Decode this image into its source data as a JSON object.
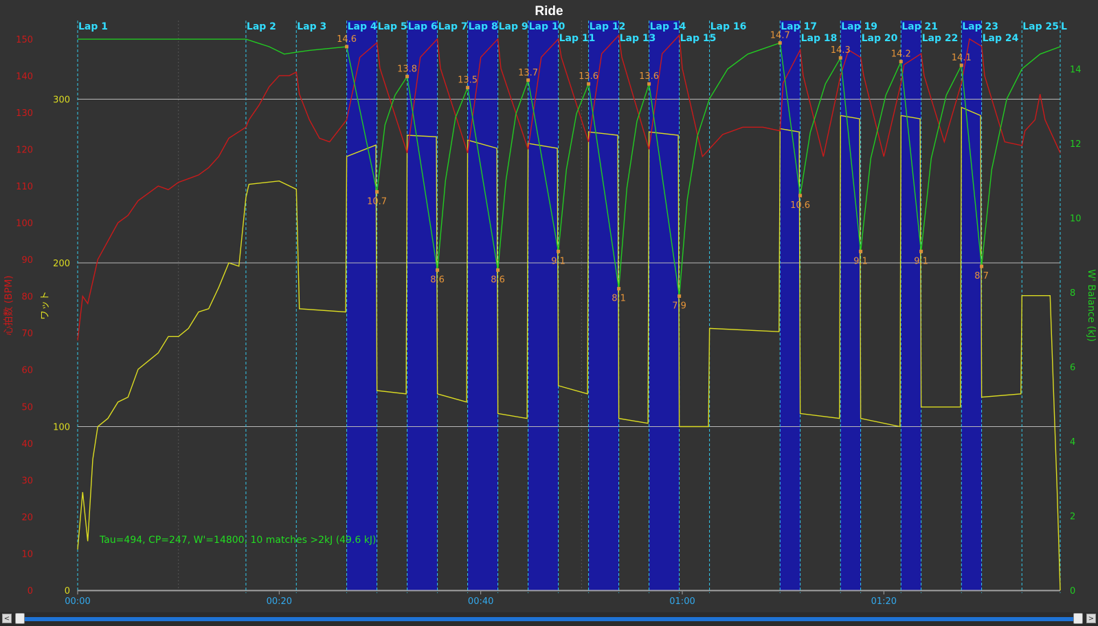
{
  "chart_data": {
    "type": "line",
    "title": "Ride",
    "x_axis": {
      "label": "",
      "ticks": [
        "00:00",
        "00:20",
        "00:40",
        "01:00",
        "01:20"
      ],
      "range_minutes": [
        0,
        97.5
      ]
    },
    "y_axes": [
      {
        "id": "hr",
        "label": "心拍数 (BPM)",
        "range": [
          0,
          155
        ],
        "ticks": [
          0,
          10,
          20,
          30,
          40,
          50,
          60,
          70,
          80,
          90,
          100,
          110,
          120,
          130,
          140,
          150
        ],
        "color": "#cc1a1a"
      },
      {
        "id": "power",
        "label": "ワット",
        "range": [
          0,
          348
        ],
        "ticks": [
          100,
          200,
          300
        ],
        "color": "#dddd22"
      },
      {
        "id": "wbal",
        "label": "W' Balance (kJ)",
        "range": [
          0,
          15.3
        ],
        "ticks": [
          0,
          2,
          4,
          6,
          8,
          10,
          12,
          14
        ],
        "color": "#22cc22"
      }
    ],
    "grid": "horizontal at power ticks",
    "annotation": "Tau=494, CP=247, W'=14800, 10 matches >2kJ (49.6 kJ)",
    "laps": [
      {
        "label": "Lap 1",
        "start": 0,
        "row": 1
      },
      {
        "label": "Lap 2",
        "start": 16.7,
        "row": 1
      },
      {
        "label": "Lap 3",
        "start": 21.7,
        "row": 1
      },
      {
        "label": "Lap 4",
        "start": 26.7,
        "row": 1,
        "interval": true
      },
      {
        "label": "Lap 5",
        "start": 29.7,
        "row": 1
      },
      {
        "label": "Lap 6",
        "start": 32.7,
        "row": 1,
        "interval": true
      },
      {
        "label": "Lap 7",
        "start": 35.7,
        "row": 1
      },
      {
        "label": "Lap 8",
        "start": 38.7,
        "row": 1,
        "interval": true
      },
      {
        "label": "Lap 9",
        "start": 41.7,
        "row": 1
      },
      {
        "label": "Lap 10",
        "start": 44.7,
        "row": 1,
        "interval": true
      },
      {
        "label": "Lap 11",
        "start": 47.7,
        "row": 2
      },
      {
        "label": "Lap 12",
        "start": 50.7,
        "row": 1,
        "interval": true
      },
      {
        "label": "Lap 13",
        "start": 53.7,
        "row": 2
      },
      {
        "label": "Lap 14",
        "start": 56.7,
        "row": 1,
        "interval": true
      },
      {
        "label": "Lap 15",
        "start": 59.7,
        "row": 2
      },
      {
        "label": "Lap 16",
        "start": 62.7,
        "row": 1
      },
      {
        "label": "Lap 17",
        "start": 69.7,
        "row": 1,
        "interval": true
      },
      {
        "label": "Lap 18",
        "start": 71.7,
        "row": 2
      },
      {
        "label": "Lap 19",
        "start": 75.7,
        "row": 1,
        "interval": true
      },
      {
        "label": "Lap 20",
        "start": 77.7,
        "row": 2
      },
      {
        "label": "Lap 21",
        "start": 81.7,
        "row": 1,
        "interval": true
      },
      {
        "label": "Lap 22",
        "start": 83.7,
        "row": 2
      },
      {
        "label": "Lap 23",
        "start": 87.7,
        "row": 1,
        "interval": true
      },
      {
        "label": "Lap 24",
        "start": 89.7,
        "row": 2
      },
      {
        "label": "Lap 25",
        "start": 93.7,
        "row": 1
      },
      {
        "label": "L",
        "start": 97.5,
        "row": 1
      }
    ],
    "wbal_markers": [
      {
        "t": 26.7,
        "v": 14.6,
        "label": "14.6"
      },
      {
        "t": 29.7,
        "v": 10.7,
        "label": "10.7"
      },
      {
        "t": 32.7,
        "v": 13.8,
        "label": "13.8"
      },
      {
        "t": 35.7,
        "v": 8.6,
        "label": "8.6"
      },
      {
        "t": 38.7,
        "v": 13.5,
        "label": "13.5"
      },
      {
        "t": 41.7,
        "v": 8.6,
        "label": "8.6"
      },
      {
        "t": 44.7,
        "v": 13.7,
        "label": "13.7"
      },
      {
        "t": 47.7,
        "v": 9.1,
        "label": "9.1"
      },
      {
        "t": 50.7,
        "v": 13.6,
        "label": "13.6"
      },
      {
        "t": 53.7,
        "v": 8.1,
        "label": "8.1"
      },
      {
        "t": 56.7,
        "v": 13.6,
        "label": "13.6"
      },
      {
        "t": 59.7,
        "v": 7.9,
        "label": "7.9"
      },
      {
        "t": 69.7,
        "v": 14.7,
        "label": "14.7"
      },
      {
        "t": 71.7,
        "v": 10.6,
        "label": "10.6"
      },
      {
        "t": 75.7,
        "v": 14.3,
        "label": "14.3"
      },
      {
        "t": 77.7,
        "v": 9.1,
        "label": "9.1"
      },
      {
        "t": 81.7,
        "v": 14.2,
        "label": "14.2"
      },
      {
        "t": 83.7,
        "v": 9.1,
        "label": "9.1"
      },
      {
        "t": 87.7,
        "v": 14.1,
        "label": "14.1"
      },
      {
        "t": 89.7,
        "v": 8.7,
        "label": "8.7"
      }
    ],
    "series": [
      {
        "name": "Power",
        "axis": "power",
        "color": "#dddd22",
        "points": [
          [
            0,
            25
          ],
          [
            0.5,
            60
          ],
          [
            1,
            30
          ],
          [
            1.5,
            80
          ],
          [
            2,
            100
          ],
          [
            3,
            105
          ],
          [
            4,
            115
          ],
          [
            5,
            118
          ],
          [
            6,
            135
          ],
          [
            7,
            140
          ],
          [
            8,
            145
          ],
          [
            9,
            155
          ],
          [
            10,
            155
          ],
          [
            11,
            160
          ],
          [
            12,
            170
          ],
          [
            13,
            172
          ],
          [
            14,
            185
          ],
          [
            15,
            200
          ],
          [
            16,
            198
          ],
          [
            16.7,
            240
          ],
          [
            17,
            248
          ],
          [
            20,
            250
          ],
          [
            21.7,
            245
          ],
          [
            22,
            172
          ],
          [
            26.6,
            170
          ],
          [
            26.7,
            265
          ],
          [
            29.6,
            272
          ],
          [
            29.7,
            122
          ],
          [
            32.6,
            120
          ],
          [
            32.7,
            278
          ],
          [
            35.6,
            277
          ],
          [
            35.7,
            120
          ],
          [
            38.6,
            115
          ],
          [
            38.7,
            275
          ],
          [
            41.6,
            270
          ],
          [
            41.7,
            108
          ],
          [
            44.6,
            105
          ],
          [
            44.7,
            273
          ],
          [
            47.6,
            270
          ],
          [
            47.7,
            125
          ],
          [
            50.6,
            120
          ],
          [
            50.7,
            280
          ],
          [
            53.6,
            278
          ],
          [
            53.7,
            105
          ],
          [
            56.6,
            102
          ],
          [
            56.7,
            280
          ],
          [
            59.6,
            278
          ],
          [
            59.7,
            100
          ],
          [
            62.6,
            100
          ],
          [
            62.7,
            160
          ],
          [
            69.6,
            158
          ],
          [
            69.7,
            282
          ],
          [
            71.6,
            280
          ],
          [
            71.7,
            108
          ],
          [
            75.6,
            105
          ],
          [
            75.7,
            290
          ],
          [
            77.6,
            288
          ],
          [
            77.7,
            105
          ],
          [
            81.6,
            100
          ],
          [
            81.7,
            290
          ],
          [
            83.6,
            288
          ],
          [
            83.7,
            112
          ],
          [
            87.6,
            112
          ],
          [
            87.7,
            295
          ],
          [
            89.6,
            290
          ],
          [
            89.7,
            118
          ],
          [
            93.6,
            120
          ],
          [
            93.7,
            180
          ],
          [
            96.5,
            180
          ],
          [
            97.2,
            60
          ],
          [
            97.5,
            0
          ]
        ]
      },
      {
        "name": "Heart Rate",
        "axis": "hr",
        "color": "#cc1a1a",
        "points": [
          [
            0,
            68
          ],
          [
            0.5,
            80
          ],
          [
            1,
            78
          ],
          [
            2,
            90
          ],
          [
            3,
            95
          ],
          [
            4,
            100
          ],
          [
            5,
            102
          ],
          [
            6,
            106
          ],
          [
            7,
            108
          ],
          [
            8,
            110
          ],
          [
            9,
            109
          ],
          [
            10,
            111
          ],
          [
            11,
            112
          ],
          [
            12,
            113
          ],
          [
            13,
            115
          ],
          [
            14,
            118
          ],
          [
            15,
            123
          ],
          [
            16.7,
            126
          ],
          [
            17,
            128
          ],
          [
            18,
            132
          ],
          [
            19,
            137
          ],
          [
            20,
            140
          ],
          [
            21,
            140
          ],
          [
            21.7,
            141
          ],
          [
            22,
            135
          ],
          [
            23,
            128
          ],
          [
            24,
            123
          ],
          [
            25,
            122
          ],
          [
            26.7,
            128
          ],
          [
            28,
            145
          ],
          [
            29.7,
            149
          ],
          [
            30,
            142
          ],
          [
            32.7,
            119
          ],
          [
            34,
            145
          ],
          [
            35.7,
            150
          ],
          [
            36,
            142
          ],
          [
            38.7,
            119
          ],
          [
            40,
            145
          ],
          [
            41.7,
            150
          ],
          [
            42,
            142
          ],
          [
            44.7,
            120
          ],
          [
            46,
            145
          ],
          [
            47.7,
            150
          ],
          [
            48,
            145
          ],
          [
            50.7,
            122
          ],
          [
            52,
            146
          ],
          [
            53.7,
            151
          ],
          [
            54,
            145
          ],
          [
            56.7,
            120
          ],
          [
            58,
            146
          ],
          [
            59.7,
            151
          ],
          [
            60,
            142
          ],
          [
            62,
            118
          ],
          [
            64,
            124
          ],
          [
            66,
            126
          ],
          [
            68,
            126
          ],
          [
            69.7,
            125
          ],
          [
            70,
            138
          ],
          [
            71.7,
            147
          ],
          [
            72,
            140
          ],
          [
            74,
            118
          ],
          [
            75.7,
            140
          ],
          [
            76.5,
            147
          ],
          [
            77.7,
            145
          ],
          [
            78,
            140
          ],
          [
            80,
            118
          ],
          [
            81.7,
            138
          ],
          [
            82,
            143
          ],
          [
            83.7,
            146
          ],
          [
            84,
            140
          ],
          [
            86,
            122
          ],
          [
            87.7,
            138
          ],
          [
            88.5,
            150
          ],
          [
            89.7,
            148
          ],
          [
            90,
            140
          ],
          [
            92,
            122
          ],
          [
            93.7,
            121
          ],
          [
            94,
            125
          ],
          [
            95,
            128
          ],
          [
            95.5,
            135
          ],
          [
            96,
            128
          ],
          [
            97.5,
            119
          ]
        ]
      },
      {
        "name": "W' Balance",
        "axis": "wbal",
        "color": "#22cc22",
        "points": [
          [
            0,
            14.8
          ],
          [
            16.7,
            14.8
          ],
          [
            19,
            14.6
          ],
          [
            20.5,
            14.4
          ],
          [
            21.7,
            14.45
          ],
          [
            23,
            14.5
          ],
          [
            26.7,
            14.6
          ],
          [
            29.7,
            10.7
          ],
          [
            30.5,
            12.5
          ],
          [
            31.5,
            13.3
          ],
          [
            32.7,
            13.8
          ],
          [
            35.7,
            8.6
          ],
          [
            36.5,
            11
          ],
          [
            37.5,
            12.7
          ],
          [
            38.7,
            13.5
          ],
          [
            41.7,
            8.6
          ],
          [
            42.5,
            11
          ],
          [
            43.5,
            12.8
          ],
          [
            44.7,
            13.7
          ],
          [
            47.7,
            9.1
          ],
          [
            48.5,
            11.3
          ],
          [
            49.5,
            12.8
          ],
          [
            50.7,
            13.6
          ],
          [
            53.7,
            8.1
          ],
          [
            54.5,
            10.8
          ],
          [
            55.5,
            12.6
          ],
          [
            56.7,
            13.6
          ],
          [
            59.7,
            7.9
          ],
          [
            60.5,
            10.5
          ],
          [
            61.5,
            12.2
          ],
          [
            62.7,
            13.2
          ],
          [
            64.5,
            14
          ],
          [
            66.5,
            14.4
          ],
          [
            69.7,
            14.7
          ],
          [
            71.7,
            10.6
          ],
          [
            72.7,
            12.3
          ],
          [
            74.2,
            13.6
          ],
          [
            75.7,
            14.3
          ],
          [
            77.7,
            9.1
          ],
          [
            78.7,
            11.6
          ],
          [
            80.2,
            13.3
          ],
          [
            81.7,
            14.2
          ],
          [
            83.7,
            9.1
          ],
          [
            84.7,
            11.6
          ],
          [
            86.2,
            13.3
          ],
          [
            87.7,
            14.1
          ],
          [
            89.7,
            8.7
          ],
          [
            90.7,
            11.3
          ],
          [
            92.2,
            13.2
          ],
          [
            93.7,
            14
          ],
          [
            95.5,
            14.4
          ],
          [
            97.5,
            14.6
          ]
        ]
      }
    ]
  },
  "controls": {
    "scroll_left": "<",
    "scroll_right": ">"
  }
}
